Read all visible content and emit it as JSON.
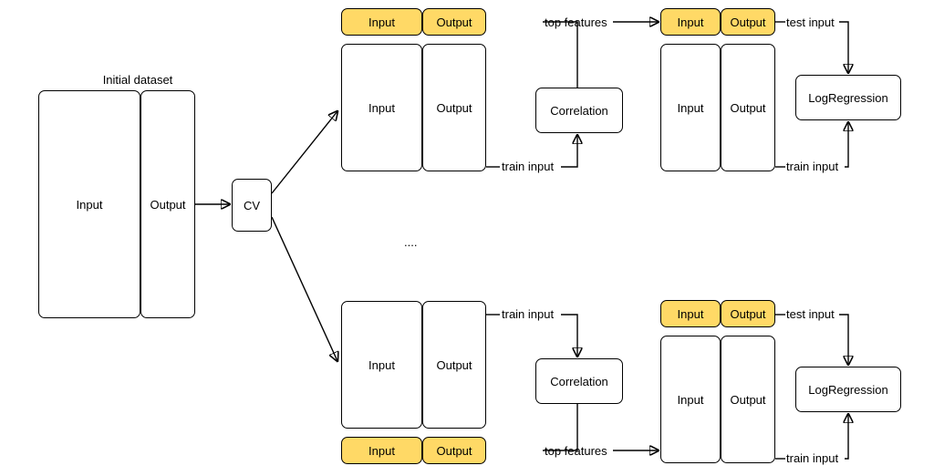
{
  "title": "Initial dataset",
  "initial": {
    "input": "Input",
    "output": "Output"
  },
  "cv": "CV",
  "ellipsis": "....",
  "fold_top": {
    "header_input": "Input",
    "header_output": "Output",
    "body_input": "Input",
    "body_output": "Output"
  },
  "fold_bottom": {
    "header_input": "Input",
    "header_output": "Output",
    "body_input": "Input",
    "body_output": "Output"
  },
  "corr_top": "Correlation",
  "corr_bottom": "Correlation",
  "sel_top": {
    "header_input": "Input",
    "header_output": "Output",
    "body_input": "Input",
    "body_output": "Output"
  },
  "sel_bottom": {
    "header_input": "Input",
    "header_output": "Output",
    "body_input": "Input",
    "body_output": "Output"
  },
  "model_top": "LogRegression",
  "model_bottom": "LogRegression",
  "edge_labels": {
    "train_input_top": "train input",
    "top_features_top": "top features",
    "test_input_top": "test input",
    "train_input_top2": "train input",
    "train_input_bot": "train input",
    "top_features_bot": "top features",
    "test_input_bot": "test input",
    "train_input_bot2": "train input"
  }
}
